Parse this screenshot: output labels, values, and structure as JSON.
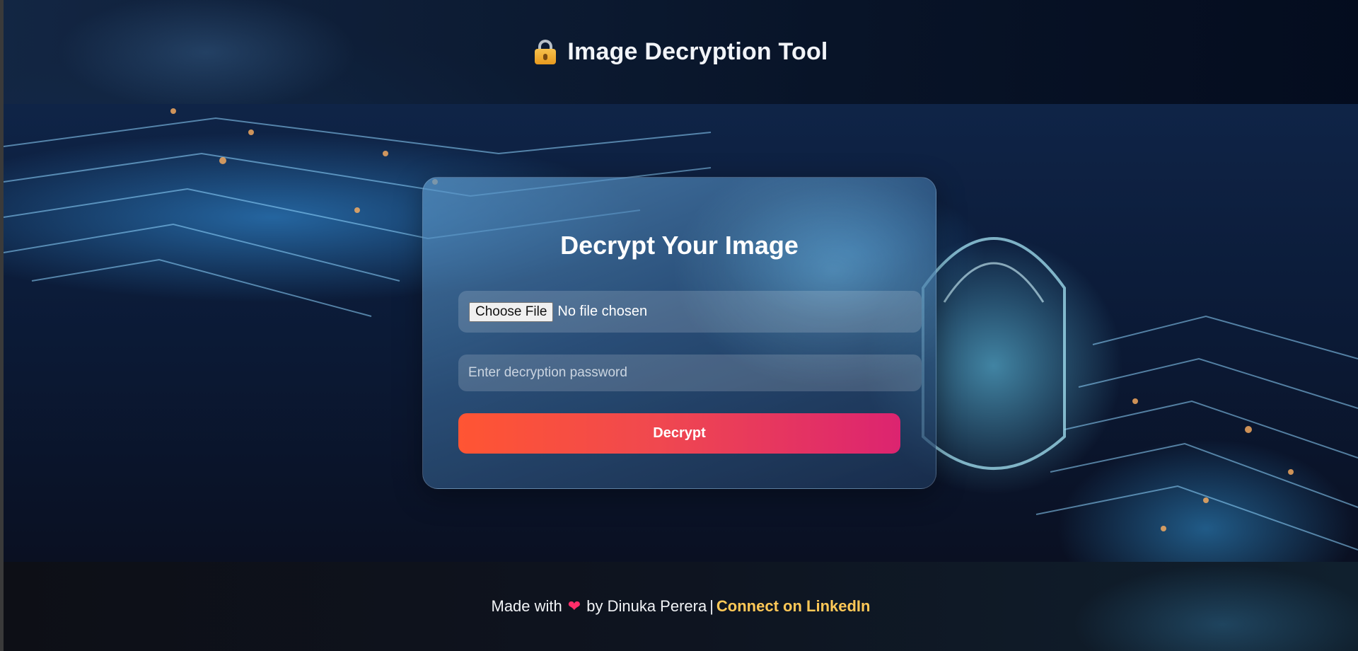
{
  "header": {
    "icon": "lock-icon",
    "title": "Image Decryption Tool"
  },
  "card": {
    "title": "Decrypt Your Image",
    "file_input": {
      "button_label": "Choose File",
      "status": "No file chosen"
    },
    "password": {
      "value": "",
      "placeholder": "Enter decryption password"
    },
    "decrypt_label": "Decrypt"
  },
  "footer": {
    "made_with": "Made with",
    "heart_icon": "heart-icon",
    "by": "by Dinuka Perera",
    "separator": "|",
    "link_text": "Connect on LinkedIn"
  },
  "colors": {
    "accent_start": "#ff5533",
    "accent_end": "#dc2470",
    "link": "#ffc857"
  }
}
